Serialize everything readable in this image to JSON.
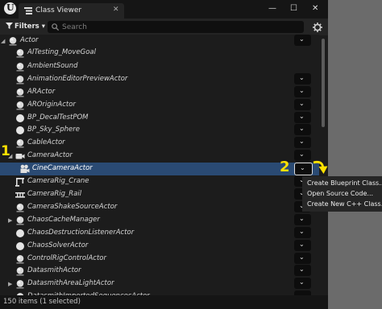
{
  "window": {
    "logo_letter": "U",
    "tab_title": "Class Viewer",
    "tab_close": "✕",
    "minimize": "—",
    "maximize": "☐",
    "close": "✕"
  },
  "toolbar": {
    "filters_label": "Filters",
    "filters_caret": "▾",
    "search_placeholder": "Search"
  },
  "tree": {
    "dropdown_glyph": "⌄",
    "rows": [
      {
        "label": "Actor",
        "arrow": "◢",
        "icon": "sphere-icon"
      },
      {
        "label": "AITesting_MoveGoal",
        "arrow": "",
        "icon": "sphere-icon"
      },
      {
        "label": "AmbientSound",
        "arrow": "",
        "icon": "sphere-icon"
      },
      {
        "label": "AnimationEditorPreviewActor",
        "arrow": "",
        "icon": "sphere-icon"
      },
      {
        "label": "ARActor",
        "arrow": "",
        "icon": "sphere-icon"
      },
      {
        "label": "AROriginActor",
        "arrow": "",
        "icon": "sphere-icon"
      },
      {
        "label": "BP_DecalTestPOM",
        "arrow": "",
        "icon": "circle-icon"
      },
      {
        "label": "BP_Sky_Sphere",
        "arrow": "",
        "icon": "circle-icon"
      },
      {
        "label": "CableActor",
        "arrow": "",
        "icon": "sphere-icon"
      },
      {
        "label": "CameraActor",
        "arrow": "◢",
        "icon": "camera-icon"
      },
      {
        "label": "CineCameraActor",
        "arrow": "",
        "icon": "cine-camera-icon"
      },
      {
        "label": "CameraRig_Crane",
        "arrow": "",
        "icon": "crane-icon"
      },
      {
        "label": "CameraRig_Rail",
        "arrow": "",
        "icon": "rail-icon"
      },
      {
        "label": "CameraShakeSourceActor",
        "arrow": "",
        "icon": "sphere-icon"
      },
      {
        "label": "ChaosCacheManager",
        "arrow": "▶",
        "icon": "sphere-icon"
      },
      {
        "label": "ChaosDestructionListenerActor",
        "arrow": "",
        "icon": "circle-icon"
      },
      {
        "label": "ChaosSolverActor",
        "arrow": "",
        "icon": "circle-icon"
      },
      {
        "label": "ControlRigControlActor",
        "arrow": "",
        "icon": "sphere-icon"
      },
      {
        "label": "DatasmithActor",
        "arrow": "",
        "icon": "sphere-icon"
      },
      {
        "label": "DatasmithAreaLightActor",
        "arrow": "▶",
        "icon": "sphere-icon"
      },
      {
        "label": "DatasmithImportedSequencesActor",
        "arrow": "",
        "icon": "sphere-icon"
      }
    ]
  },
  "status": {
    "text": "150 items (1 selected)"
  },
  "annotations": {
    "step1": "1",
    "step2": "2"
  },
  "context_menu": {
    "items": [
      "Create Blueprint Class...",
      "Open Source Code...",
      "Create New C++ Class..."
    ]
  },
  "colors": {
    "selection": "#2a4a73",
    "annotation": "#ffe100",
    "background": "#1c1c1c"
  }
}
